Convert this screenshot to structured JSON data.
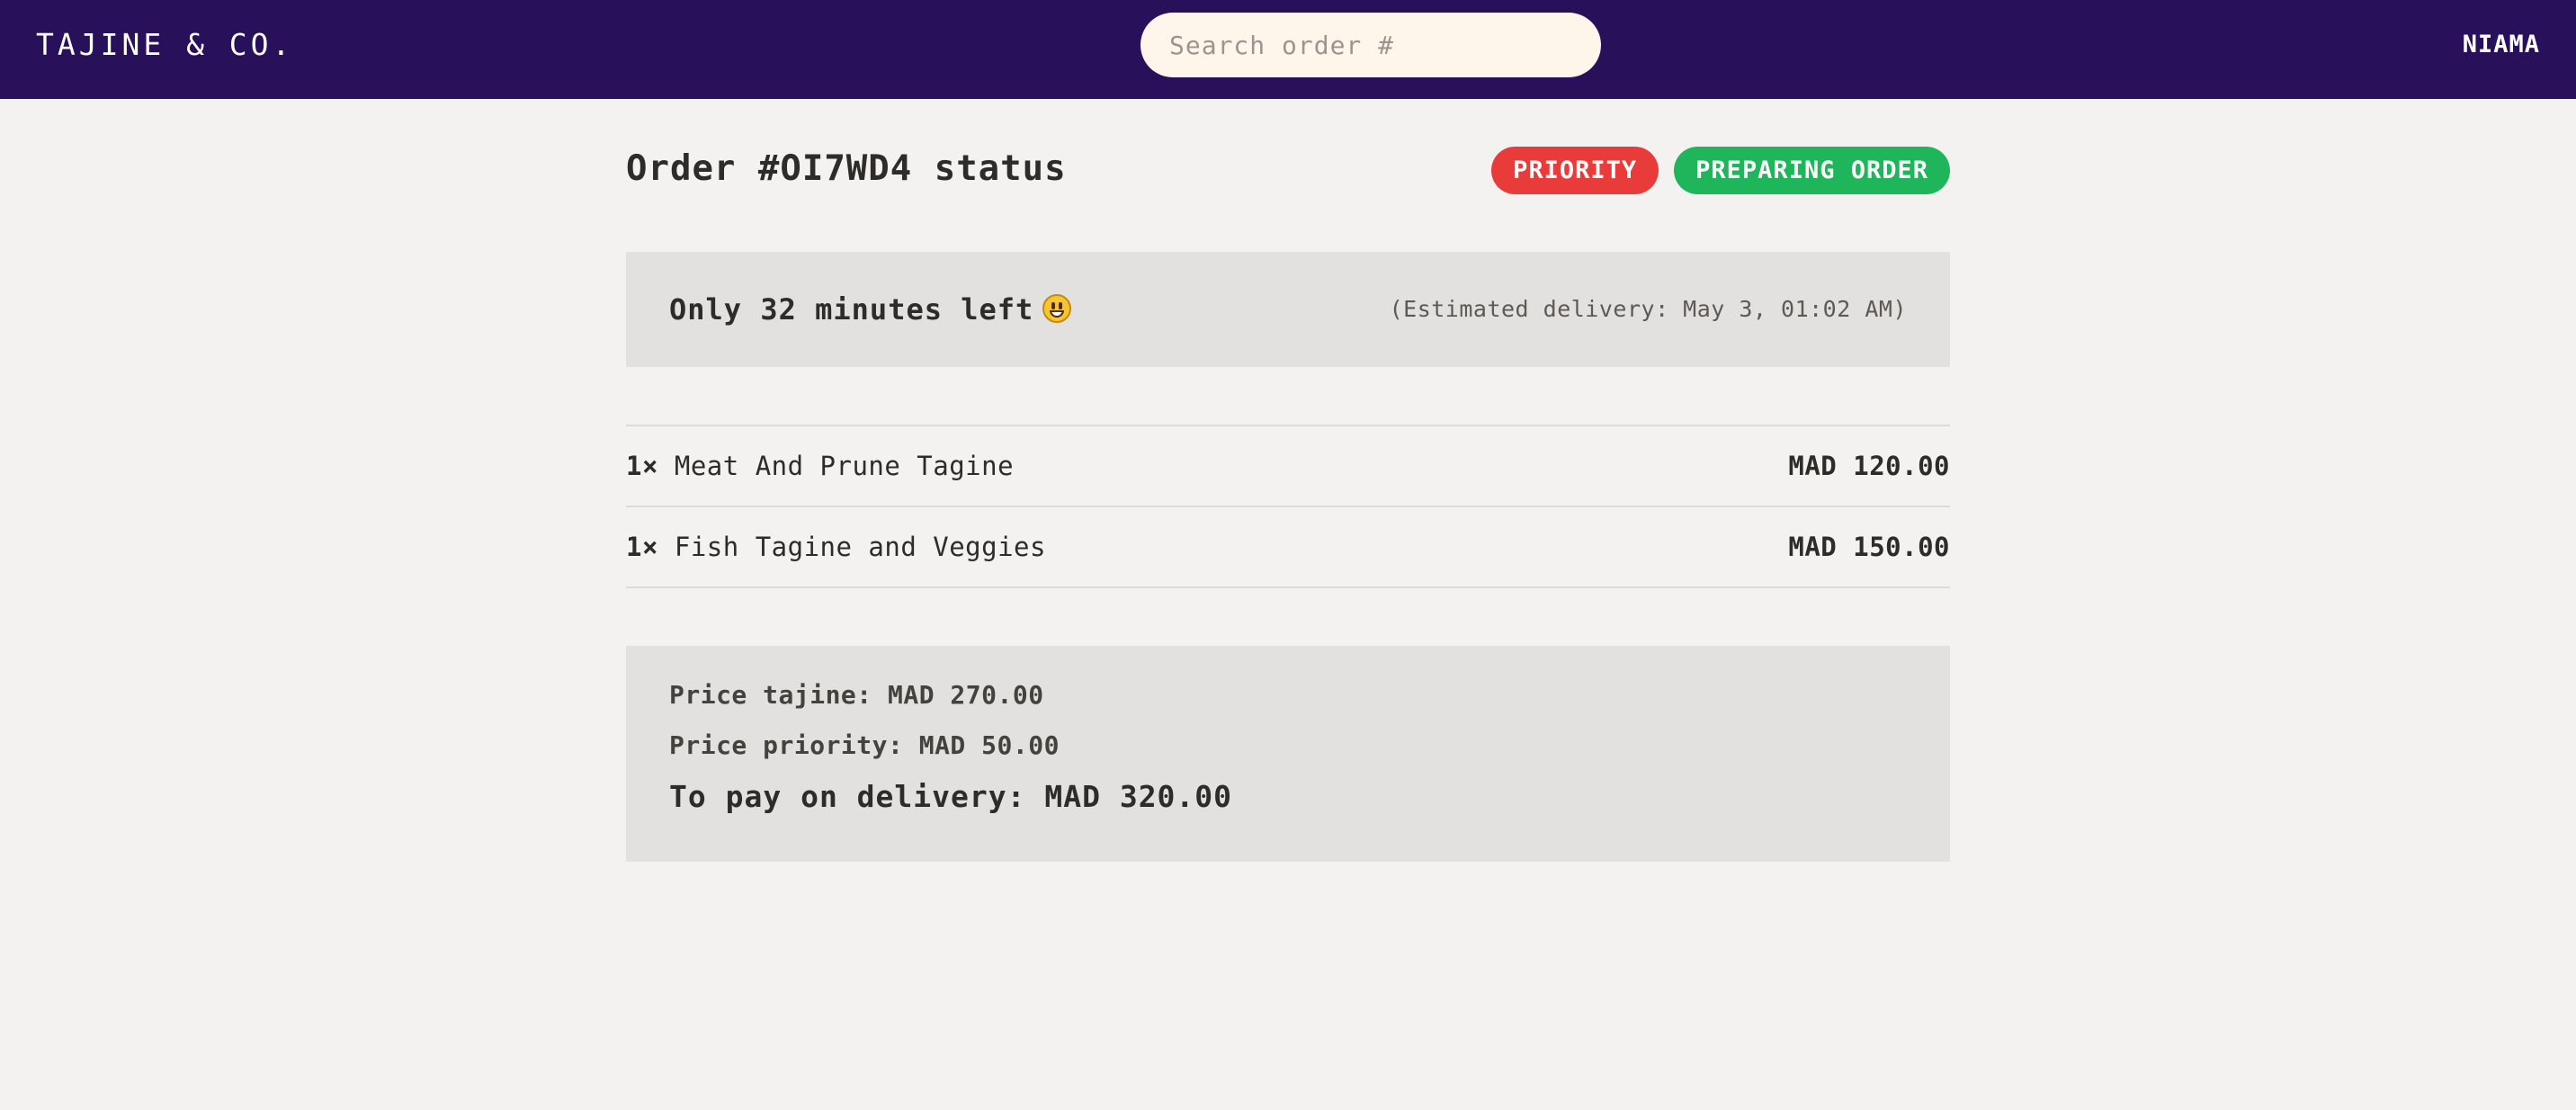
{
  "header": {
    "brand": "TAJINE & CO.",
    "search_placeholder": "Search order #",
    "search_value": "",
    "user": "NIAMA",
    "background_color": "#29105a"
  },
  "order": {
    "title": "Order #OI7WD4 status",
    "badges": {
      "priority": "PRIORITY",
      "status": "PREPARING ORDER",
      "priority_color": "#ea3b3b",
      "status_color": "#1fb55a"
    },
    "time_left": "Only 32 minutes left",
    "time_emoji": "smiling-face-icon",
    "estimated_delivery": "(Estimated delivery: May 3, 01:02 AM)",
    "items": [
      {
        "qty": "1×",
        "name": "Meat And Prune Tagine",
        "price": "MAD 120.00"
      },
      {
        "qty": "1×",
        "name": "Fish Tagine and Veggies",
        "price": "MAD 150.00"
      }
    ],
    "summary": {
      "price_tajine": "Price tajine: MAD 270.00",
      "price_priority": "Price priority: MAD 50.00",
      "to_pay": "To pay on delivery: MAD 320.00"
    }
  }
}
